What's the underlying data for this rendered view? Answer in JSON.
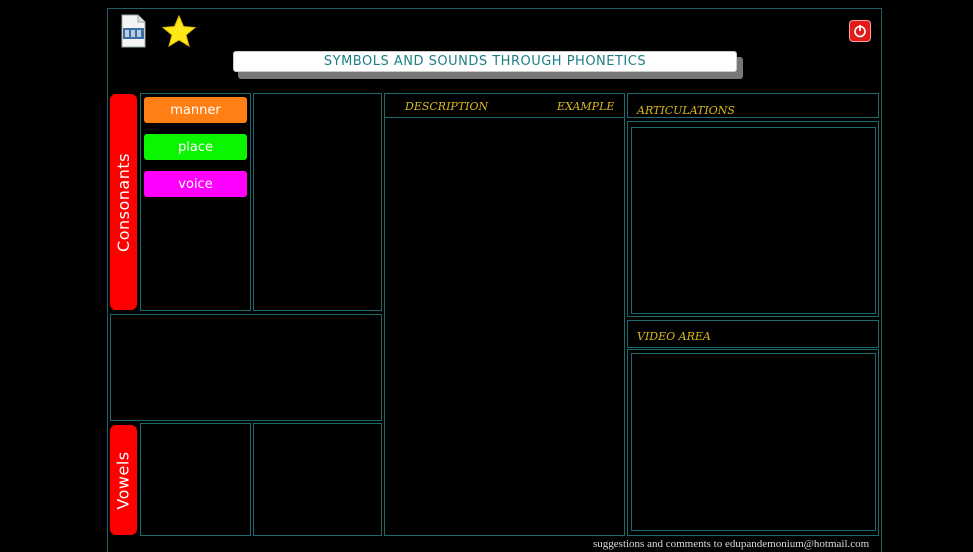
{
  "header": {
    "title": "SYMBOLS AND SOUNDS THROUGH PHONETICS",
    "icons": [
      "film-document-icon",
      "star-icon",
      "power-icon"
    ]
  },
  "consonants": {
    "label": "Consonants",
    "buttons": [
      {
        "label": "manner",
        "color": "#ff7f14"
      },
      {
        "label": "place",
        "color": "#0bf400"
      },
      {
        "label": "voice",
        "color": "#ff00ff"
      }
    ]
  },
  "vowels": {
    "label": "Vowels"
  },
  "center": {
    "description_label": "DESCRIPTION",
    "example_label": "EXAMPLE"
  },
  "right": {
    "articulations_label": "ARTICULATIONS",
    "video_label": "VIDEO AREA"
  },
  "footer": {
    "text": "suggestions and comments to edupandemonium@hotmail.com"
  },
  "colors": {
    "background": "#000000",
    "border": "#1d6a6e",
    "tab": "#ff0000",
    "title_text": "#1d7f86",
    "label_gold": "#d9b81c"
  }
}
